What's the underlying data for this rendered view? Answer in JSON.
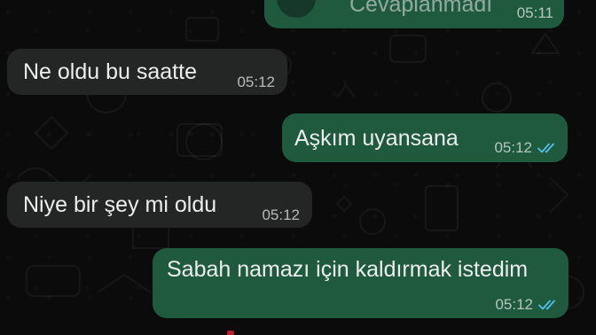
{
  "chat": {
    "partial_top": {
      "text": "Cevaplanmadı",
      "time": "05:11"
    },
    "messages": [
      {
        "direction": "incoming",
        "text": "Ne oldu bu saatte",
        "time": "05:12"
      },
      {
        "direction": "outgoing",
        "text": "Aşkım uyansana",
        "time": "05:12",
        "status": "read"
      },
      {
        "direction": "incoming",
        "text": "Niye bir şey mi oldu",
        "time": "05:12"
      },
      {
        "direction": "outgoing",
        "text": "Sabah namazı için kaldırmak istedim",
        "time": "05:12",
        "status": "read"
      }
    ]
  },
  "colors": {
    "background": "#0b0b0b",
    "incoming_bubble": "#242626",
    "outgoing_bubble": "#1f5a3f",
    "read_ticks": "#53bdeb",
    "text": "#ededed"
  },
  "icons": {
    "read_status": "double-check-icon"
  }
}
